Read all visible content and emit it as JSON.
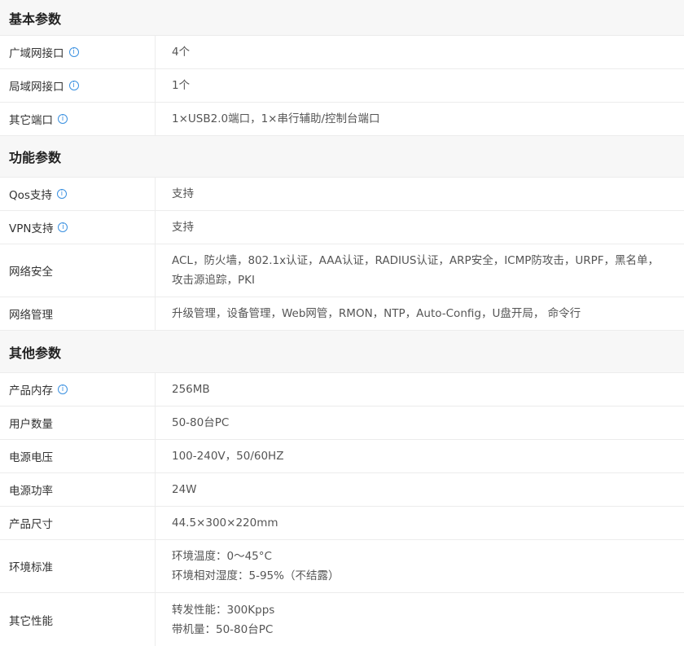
{
  "sections": [
    {
      "title": "基本参数",
      "rows": [
        {
          "label": "广域网接口",
          "info": true,
          "lines": [
            "4个"
          ]
        },
        {
          "label": "局域网接口",
          "info": true,
          "lines": [
            "1个"
          ]
        },
        {
          "label": "其它端口",
          "info": true,
          "lines": [
            "1×USB2.0端口，1×串行辅助/控制台端口"
          ]
        }
      ]
    },
    {
      "title": "功能参数",
      "rows": [
        {
          "label": "Qos支持",
          "info": true,
          "lines": [
            "支持"
          ]
        },
        {
          "label": "VPN支持",
          "info": true,
          "lines": [
            "支持"
          ]
        },
        {
          "label": "网络安全",
          "info": false,
          "lines": [
            "ACL，防火墙，802.1x认证，AAA认证，RADIUS认证，ARP安全，ICMP防攻击，URPF，黑名单，",
            "攻击源追踪，PKI"
          ]
        },
        {
          "label": "网络管理",
          "info": false,
          "lines": [
            "升级管理，设备管理，Web网管，RMON，NTP，Auto-Config，U盘开局， 命令行"
          ]
        }
      ]
    },
    {
      "title": "其他参数",
      "rows": [
        {
          "label": "产品内存",
          "info": true,
          "lines": [
            "256MB"
          ]
        },
        {
          "label": "用户数量",
          "info": false,
          "lines": [
            "50-80台PC"
          ]
        },
        {
          "label": "电源电压",
          "info": false,
          "lines": [
            "100-240V，50/60HZ"
          ]
        },
        {
          "label": "电源功率",
          "info": false,
          "lines": [
            "24W"
          ]
        },
        {
          "label": "产品尺寸",
          "info": false,
          "lines": [
            "44.5×300×220mm"
          ]
        },
        {
          "label": "环境标准",
          "info": false,
          "lines": [
            "环境温度：0～45°C",
            "环境相对湿度：5-95%（不结露）"
          ]
        },
        {
          "label": "其它性能",
          "info": false,
          "lines": [
            "转发性能：300Kpps",
            "带机量：50-80台PC"
          ]
        }
      ]
    }
  ],
  "icons": {
    "info": "info-circle-icon",
    "info_glyph": "i",
    "accent": "#3a90e0"
  }
}
